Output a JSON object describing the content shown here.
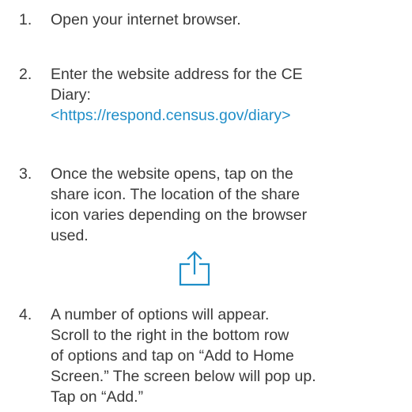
{
  "steps": [
    {
      "number": "1.",
      "lines": [
        "Open your internet browser."
      ]
    },
    {
      "number": "2.",
      "lines": [
        "Enter the website address for the CE",
        "Diary:"
      ],
      "link": "<https://respond.census.gov/diary>"
    },
    {
      "number": "3.",
      "lines": [
        "Once the website opens, tap on the",
        "share icon. The location of the share",
        "icon varies depending on the browser",
        "used."
      ]
    },
    {
      "number": "4.",
      "lines": [
        "A number of options will appear.",
        "Scroll to the right in the bottom row",
        "of options and tap on “Add to Home",
        "Screen.” The screen below will pop up.",
        "Tap on “Add.”"
      ]
    }
  ],
  "colors": {
    "text": "#3a3a3a",
    "link": "#1f8ec8",
    "icon": "#1f8ec8"
  },
  "icons": {
    "share": "share-icon"
  }
}
